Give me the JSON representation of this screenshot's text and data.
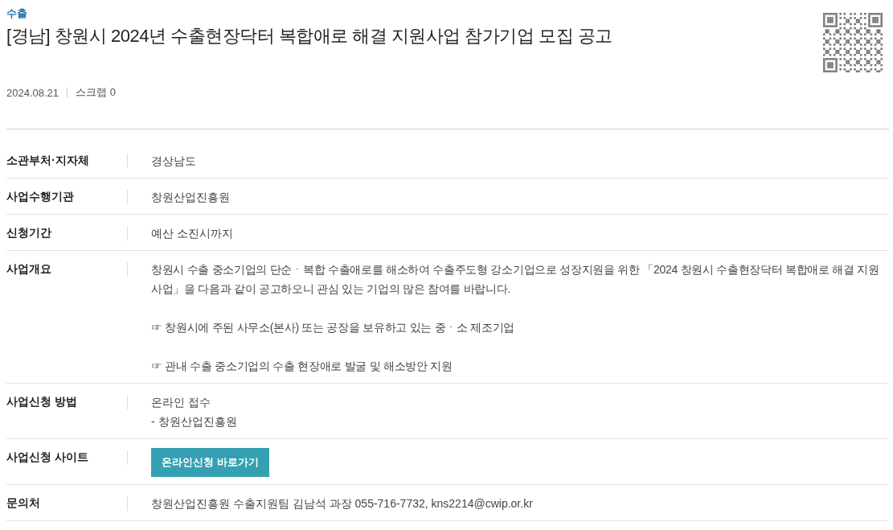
{
  "category": "수출",
  "title": "[경남] 창원시 2024년 수출현장닥터 복합애로 해결 지원사업 참가기업 모집 공고",
  "meta": {
    "date": "2024.08.21",
    "scrap": "스크랩 0"
  },
  "rows": [
    {
      "label": "소관부처·지자체",
      "kind": "text",
      "lines": [
        "경상남도"
      ]
    },
    {
      "label": "사업수행기관",
      "kind": "text",
      "lines": [
        "창원산업진흥원"
      ]
    },
    {
      "label": "신청기간",
      "kind": "text",
      "lines": [
        "예산 소진시까지"
      ]
    },
    {
      "label": "사업개요",
      "kind": "paragraphs",
      "lines": [
        "창원시 수출 중소기업의 단순ㆍ복합 수출애로를 해소하여 수출주도형 강소기업으로 성장지원을 위한 「2024 창원시 수출현장닥터 복합애로 해결 지원사업」을 다음과 같이 공고하오니 관심 있는 기업의 많은 참여를 바랍니다.",
        "☞ 창원시에 주된 사무소(본사) 또는 공장을 보유하고 있는 중ㆍ소 제조기업",
        "☞ 관내 수출 중소기업의 수출 현장애로 발굴 및 해소방안 지원"
      ]
    },
    {
      "label": "사업신청 방법",
      "kind": "text",
      "lines": [
        "온라인 접수",
        "- 창원산업진흥원"
      ]
    },
    {
      "label": "사업신청 사이트",
      "kind": "button",
      "lines": [
        "온라인신청 바로가기"
      ]
    },
    {
      "label": "문의처",
      "kind": "text",
      "lines": [
        "창원산업진흥원 수출지원팀 김남석 과장 055-716-7732, kns2214@cwip.or.kr"
      ]
    }
  ]
}
